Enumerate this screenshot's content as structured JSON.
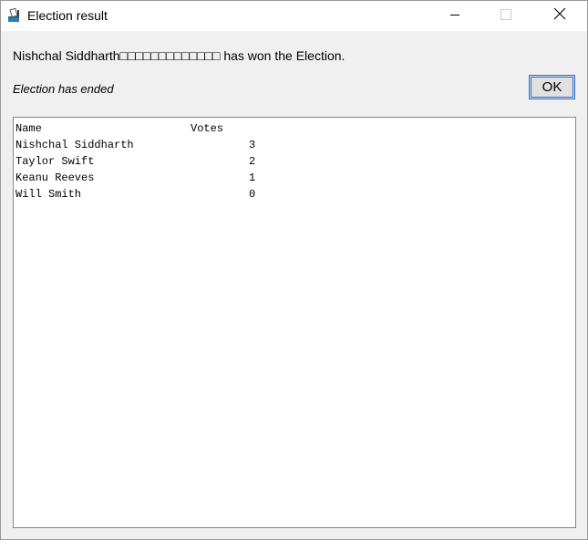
{
  "window": {
    "title": "Election result",
    "icon": "ballot-box-icon"
  },
  "titlebar_buttons": {
    "minimize_icon": "minimize-icon",
    "maximize_icon": "maximize-icon",
    "close_icon": "close-icon"
  },
  "message": "Nishchal Siddharth□□□□□□□□□□□□□ has won the Election.",
  "status": "Election has ended",
  "ok_button": {
    "label": "OK"
  },
  "results": {
    "columns": [
      "Name",
      "Votes"
    ],
    "rows": [
      {
        "name": "Nishchal Siddharth",
        "votes": "3"
      },
      {
        "name": "Taylor Swift",
        "votes": "2"
      },
      {
        "name": "Keanu Reeves",
        "votes": "1"
      },
      {
        "name": "Will Smith",
        "votes": "0"
      }
    ]
  }
}
